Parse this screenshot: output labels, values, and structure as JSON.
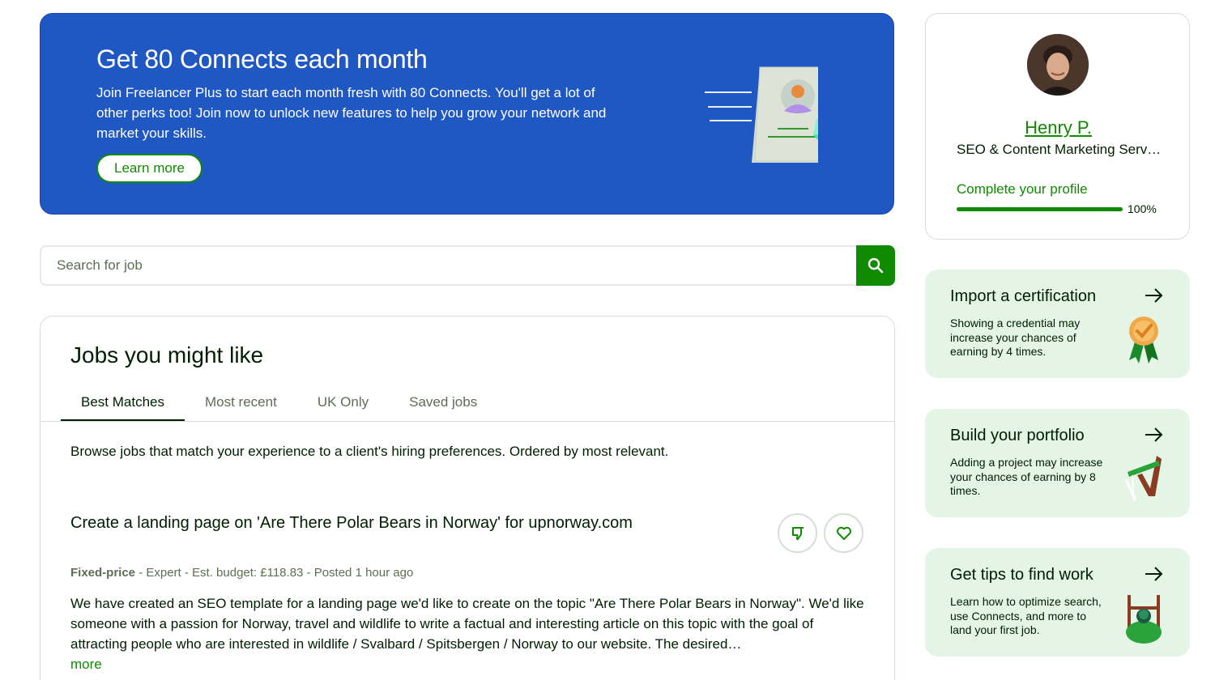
{
  "promo": {
    "title": "Get 80 Connects each month",
    "body": "Join Freelancer Plus to start each month fresh with 80 Connects. You'll get a lot of other perks too! Join now to unlock new features to help you grow your network and market your skills.",
    "button_label": "Learn more"
  },
  "search": {
    "placeholder": "Search for job",
    "icon": "search-icon"
  },
  "jobs": {
    "title": "Jobs you might like",
    "tabs": [
      {
        "label": "Best Matches",
        "active": true
      },
      {
        "label": "Most recent",
        "active": false
      },
      {
        "label": "UK Only",
        "active": false
      },
      {
        "label": "Saved jobs",
        "active": false
      }
    ],
    "description": "Browse jobs that match your experience to a client's hiring preferences. Ordered by most relevant.",
    "listing": {
      "title": "Create a landing page on 'Are There Polar Bears in Norway' for upnorway.com",
      "meta_type": "Fixed-price",
      "meta_rest": " - Expert - Est. budget: £118.83 - Posted 1 hour ago",
      "description": "We have created an SEO template for a landing page we'd like to create on the topic \"Are There Polar Bears in Norway\". We'd like someone with a passion for Norway, travel and wildlife to write a factual and interesting article on this topic with the goal of attracting people who are interested in wildlife / Svalbard / Spitsbergen / Norway to our website. The desired…",
      "more_label": "more"
    }
  },
  "profile": {
    "name": "Henry P.",
    "role": "SEO & Content Marketing Services",
    "complete_label": "Complete your profile",
    "progress_percent": 100,
    "progress_label": "100%"
  },
  "side_cards": [
    {
      "title": "Import a certification",
      "text": "Showing a credential may increase your chances of earning by 4 times."
    },
    {
      "title": "Build your portfolio",
      "text": "Adding a project may increase your chances of earning by 8 times."
    },
    {
      "title": "Get tips to find work",
      "text": "Learn how to optimize search, use Connects, and more to land your first job."
    }
  ],
  "colors": {
    "brand_green": "#108a00",
    "promo_blue": "#1f57c3",
    "card_mint": "#e4f5e6"
  }
}
